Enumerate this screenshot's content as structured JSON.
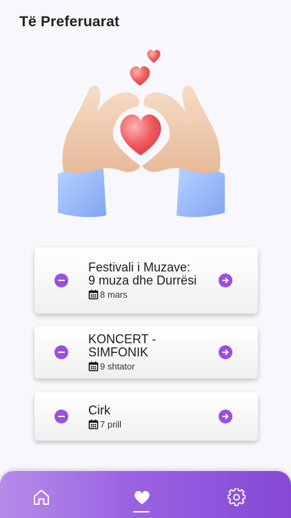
{
  "page": {
    "title": "Të Preferuarat"
  },
  "hero": {
    "illustration": "hands-heart-illustration"
  },
  "favorites": [
    {
      "title": "Festivali i Muzave: 9 muza dhe Durrësi",
      "date": "8 mars"
    },
    {
      "title": "KONCERT - SIMFONIK",
      "date": "9 shtator"
    },
    {
      "title": "Cirk",
      "date": "7 prill"
    }
  ],
  "icons": {
    "remove": "minus-circle-icon",
    "open": "arrow-right-circle-icon",
    "date": "calendar-icon"
  },
  "nav": {
    "items": [
      "home-icon",
      "heart-icon",
      "gear-icon"
    ],
    "active": "heart-icon"
  },
  "colors": {
    "accent": "#9a4fe0",
    "nav_gradient_start": "#b58ce8",
    "nav_gradient_end": "#8549d6",
    "background": "#f8f7fb"
  }
}
